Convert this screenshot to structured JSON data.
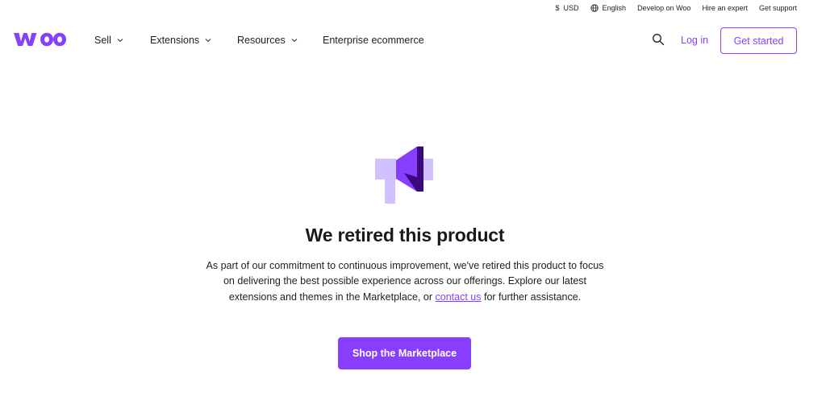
{
  "utility_bar": {
    "currency": {
      "symbol": "$",
      "label": "USD"
    },
    "language": {
      "icon": "globe-icon",
      "label": "English"
    },
    "links": [
      "Develop on Woo",
      "Hire an expert",
      "Get support"
    ]
  },
  "nav": {
    "logo_alt": "woo",
    "menu": [
      {
        "label": "Sell",
        "has_dropdown": true
      },
      {
        "label": "Extensions",
        "has_dropdown": true
      },
      {
        "label": "Resources",
        "has_dropdown": true
      },
      {
        "label": "Enterprise ecommerce",
        "has_dropdown": false
      }
    ],
    "search_icon": "search-icon",
    "login_label": "Log in",
    "get_started_label": "Get started"
  },
  "hero": {
    "illustration_icon": "megaphone-icon",
    "title": "We retired this product",
    "description_before": "As part of our commitment to continuous improvement, we've retired this product to focus on delivering the best possible experience across our offerings. Explore our latest extensions and themes in the Marketplace, or ",
    "contact_link": "contact us",
    "description_after": " for further assistance.",
    "cta_label": "Shop the Marketplace"
  },
  "colors": {
    "brand_purple": "#873eff",
    "dark_purple": "#3c087e",
    "light_purple": "#d1c1ff",
    "text": "#1e1e1e"
  }
}
